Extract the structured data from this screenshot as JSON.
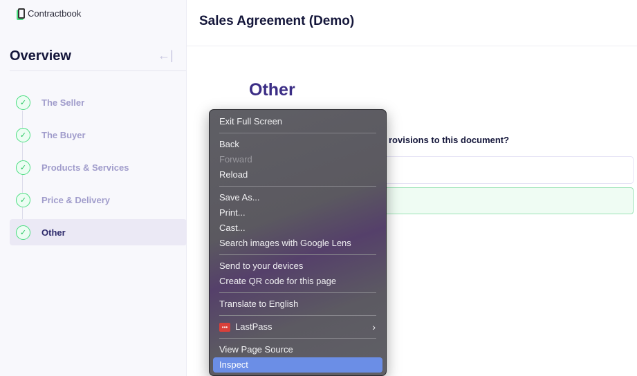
{
  "sidebar": {
    "logo": "Contractbook",
    "title": "Overview",
    "collapse_icon": "arrow-left-bar-icon",
    "steps": [
      {
        "label": "The Seller"
      },
      {
        "label": "The Buyer"
      },
      {
        "label": "Products & Services"
      },
      {
        "label": "Price & Delivery"
      },
      {
        "label": "Other",
        "active": true
      }
    ]
  },
  "header": {
    "title": "Sales Agreement (Demo)"
  },
  "main": {
    "section_title": "Other",
    "question": "rovisions to this document?"
  },
  "context_menu": {
    "items": {
      "exit": "Exit Full Screen",
      "back": "Back",
      "forward": "Forward",
      "reload": "Reload",
      "save": "Save As...",
      "print": "Print...",
      "cast": "Cast...",
      "lens": "Search images with Google Lens",
      "send": "Send to your devices",
      "qr": "Create QR code for this page",
      "translate": "Translate to English",
      "lastpass": "LastPass",
      "source": "View Page Source",
      "inspect": "Inspect"
    }
  },
  "colors": {
    "accent": "#3b2d85",
    "check": "#4ade80",
    "highlight": "#6b8ee6"
  }
}
